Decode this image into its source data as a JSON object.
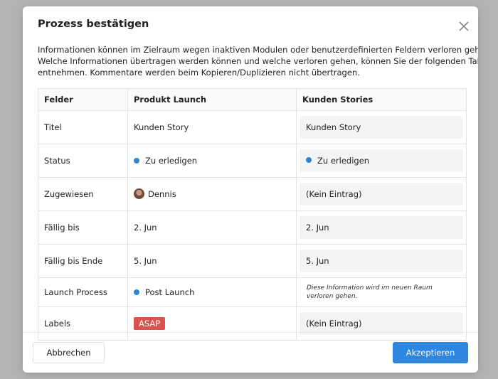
{
  "dialog": {
    "title": "Prozess bestätigen",
    "description": [
      "Informationen können im Zielraum wegen inaktiven Modulen oder benutzerdefinierten Feldern verloren gehen.",
      "Welche Informationen übertragen werden können und welche verloren gehen, können Sie der folgenden Tabelle",
      "entnehmen. Kommentare werden beim Kopieren/Duplizieren nicht übertragen."
    ]
  },
  "table": {
    "headers": [
      "Felder",
      "Produkt Launch",
      "Kunden Stories"
    ],
    "rows": [
      {
        "field": "Titel",
        "source": "Kunden Story",
        "target": "Kunden Story"
      },
      {
        "field": "Status",
        "source": "Zu erledigen",
        "target": "Zu erledigen"
      },
      {
        "field": "Zugewiesen",
        "source": "Dennis",
        "target": "(Kein Eintrag)"
      },
      {
        "field": "Fällig bis",
        "source": "2. Jun",
        "target": "2. Jun"
      },
      {
        "field": "Fällig bis Ende",
        "source": "5. Jun",
        "target": "5. Jun"
      },
      {
        "field": "Launch Process",
        "source": "Post Launch",
        "target": "Diese Information wird im neuen Raum verloren gehen."
      },
      {
        "field": "Labels",
        "source": "ASAP",
        "target": "(Kein Eintrag)"
      }
    ]
  },
  "footer": {
    "cancel_label": "Abbrechen",
    "accept_label": "Akzeptieren"
  },
  "colors": {
    "status_dot": "#2e86d1",
    "label_badge": "#d9534f",
    "primary_button": "#2e86de"
  },
  "icons": {
    "close": "close-icon",
    "assignee": "avatar"
  }
}
